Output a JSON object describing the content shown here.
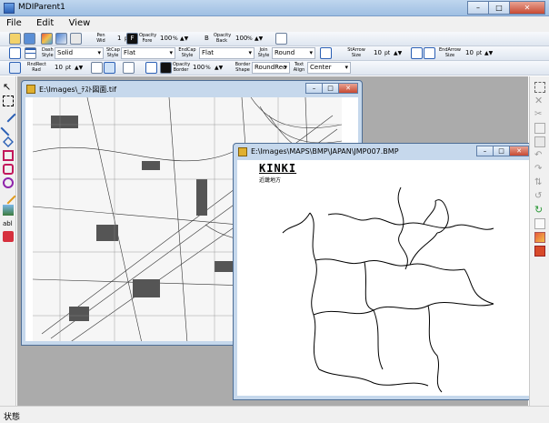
{
  "window": {
    "title": "MDIParent1"
  },
  "menu": [
    "File",
    "Edit",
    "View"
  ],
  "toolbar1": {
    "pen_wid_label": "Pen Wid",
    "pen_wid_value": "1",
    "pen_wid_unit": "pt",
    "opacity_fore_label": "Opacity Fore",
    "opacity_fore_value": "100",
    "opacity_fore_unit": "%",
    "b_label": "B",
    "opacity_back_label": "Opacity Back",
    "opacity_back_value": "100",
    "opacity_back_unit": "%"
  },
  "toolbar2": {
    "dash_style_label": "Dash Style",
    "dash_style_value": "Solid",
    "stcap_style_label": "StCap Style",
    "stcap_style_value": "Flat",
    "endcap_style_label": "EndCap Style",
    "endcap_style_value": "Flat",
    "join_style_label": "Join Style",
    "join_style_value": "Round",
    "starrow_size_label": "StArrow Size",
    "starrow_size_value": "10",
    "starrow_size_unit": "pt",
    "endarrow_size_label": "EndArrow Size",
    "endarrow_size_value": "10",
    "endarrow_size_unit": "pt"
  },
  "toolbar3": {
    "rndrect_rad_label": "RndRect Rad",
    "rndrect_rad_value": "10",
    "rndrect_rad_unit": "pt",
    "opacity_border_label": "Opacity Border",
    "opacity_border_value": "100",
    "opacity_border_unit": "%",
    "border_shape_label": "Border Shape",
    "border_shape_value": "RoundRec",
    "text_align_label": "Text Align",
    "text_align_value": "Center"
  },
  "child1": {
    "title": "E:\\Images\\_ﾃｽﾄ図面.tif"
  },
  "child2": {
    "title": "E:\\Images\\MAPS\\BMP\\JAPAN\\JMP007.BMP",
    "map_title": "KINKI",
    "map_subtitle": "近畿地方"
  },
  "child_buttons": {
    "minimize": "–",
    "maximize": "□",
    "close": "✕"
  },
  "window_buttons": {
    "minimize": "–",
    "maximize": "□",
    "close": "✕"
  },
  "status": {
    "text": "状態"
  },
  "colors": {
    "accent": "#1f5aa6",
    "mdi_bg": "#ababab"
  }
}
